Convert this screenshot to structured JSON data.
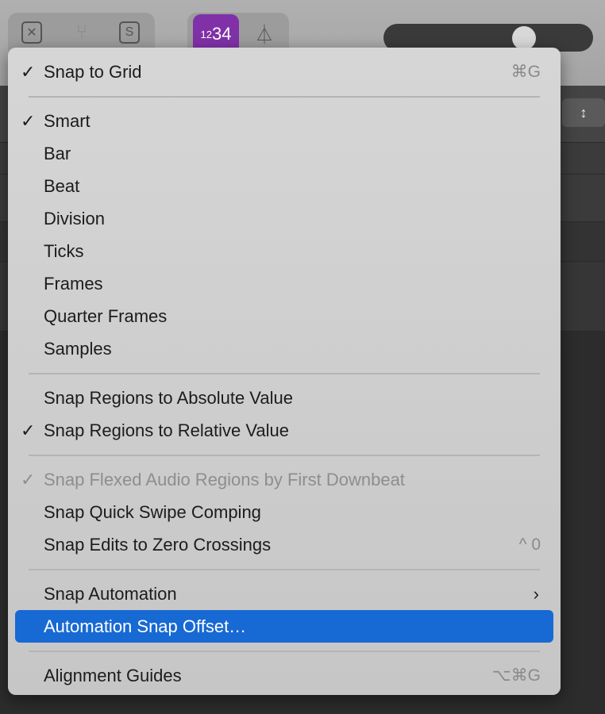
{
  "toolbar": {
    "count_in_small": "12",
    "count_in_large": "34"
  },
  "menu": {
    "groups": [
      [
        {
          "label": "Snap to Grid",
          "checked": true,
          "shortcut": "⌘G"
        }
      ],
      [
        {
          "label": "Smart",
          "checked": true
        },
        {
          "label": "Bar"
        },
        {
          "label": "Beat"
        },
        {
          "label": "Division"
        },
        {
          "label": "Ticks"
        },
        {
          "label": "Frames"
        },
        {
          "label": "Quarter Frames"
        },
        {
          "label": "Samples"
        }
      ],
      [
        {
          "label": "Snap Regions to Absolute Value"
        },
        {
          "label": "Snap Regions to Relative Value",
          "checked": true
        }
      ],
      [
        {
          "label": "Snap Flexed Audio Regions by First Downbeat",
          "checked": true,
          "disabled": true
        },
        {
          "label": "Snap Quick Swipe Comping"
        },
        {
          "label": "Snap Edits to Zero Crossings",
          "shortcut": "^ 0"
        }
      ],
      [
        {
          "label": "Snap Automation",
          "submenu": true
        },
        {
          "label": "Automation Snap Offset…",
          "highlighted": true
        }
      ],
      [
        {
          "label": "Alignment Guides",
          "shortcut": "⌥⌘G"
        }
      ]
    ]
  }
}
